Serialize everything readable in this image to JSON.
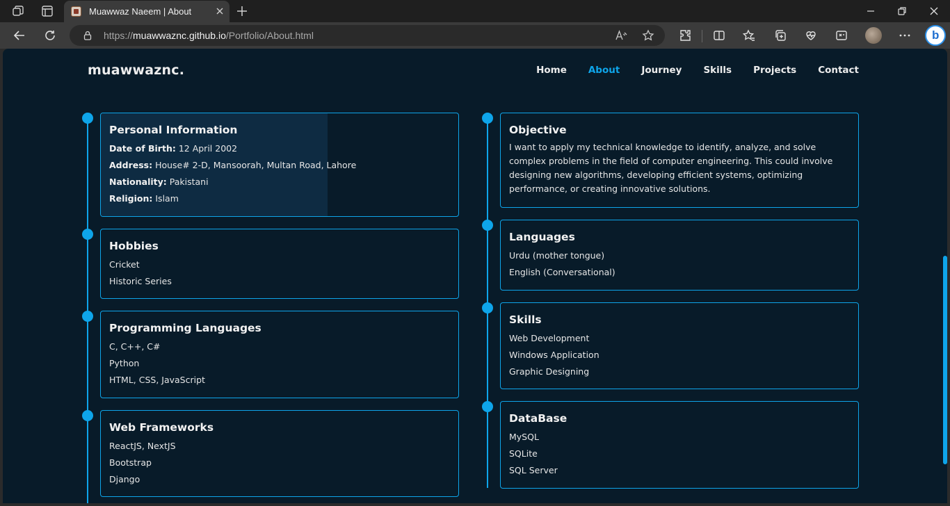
{
  "browser": {
    "tab_title": "Muawwaz Naeem | About",
    "url_host": "muawwaznc.github.io",
    "url_prefix": "https://",
    "url_path": "/Portfolio/About.html"
  },
  "site": {
    "logo": "muawwaznc.",
    "nav": [
      {
        "label": "Home"
      },
      {
        "label": "About"
      },
      {
        "label": "Journey"
      },
      {
        "label": "Skills"
      },
      {
        "label": "Projects"
      },
      {
        "label": "Contact"
      }
    ]
  },
  "cards": {
    "personal": {
      "title": "Personal Information",
      "rows": [
        {
          "key": "Date of Birth:",
          "value": " 12 April 2002"
        },
        {
          "key": "Address:",
          "value": " House# 2-D, Mansoorah, Multan Road, Lahore"
        },
        {
          "key": "Nationality:",
          "value": " Pakistani"
        },
        {
          "key": "Religion:",
          "value": " Islam"
        }
      ]
    },
    "hobbies": {
      "title": "Hobbies",
      "items": [
        "Cricket",
        "Historic Series"
      ]
    },
    "programming": {
      "title": "Programming Languages",
      "items": [
        "C, C++, C#",
        "Python",
        "HTML, CSS, JavaScript"
      ]
    },
    "frameworks": {
      "title": "Web Frameworks",
      "items": [
        "ReactJS, NextJS",
        "Bootstrap",
        "Django"
      ]
    },
    "objective": {
      "title": "Objective",
      "text": "I want to apply my technical knowledge to identify, analyze, and solve complex problems in the field of computer engineering. This could involve designing new algorithms, developing efficient systems, optimizing performance, or creating innovative solutions."
    },
    "languages": {
      "title": "Languages",
      "items": [
        "Urdu (mother tongue)",
        "English (Conversational)"
      ]
    },
    "skills": {
      "title": "Skills",
      "items": [
        "Web Development",
        "Windows Application",
        "Graphic Designing"
      ]
    },
    "database": {
      "title": "DataBase",
      "items": [
        "MySQL",
        "SQLite",
        "SQL Server"
      ]
    }
  },
  "colors": {
    "accent": "#0ea5ea",
    "background": "#081b29",
    "highlight": "#0e2b42"
  },
  "icons": [
    "workspaces-icon",
    "tab-actions-icon",
    "close-icon",
    "plus-icon",
    "minimize-icon",
    "restore-icon",
    "back-icon",
    "refresh-icon",
    "lock-icon",
    "read-aloud-icon",
    "star-icon",
    "extensions-icon",
    "split-screen-icon",
    "favorites-icon",
    "collections-icon",
    "performance-icon",
    "screenshot-icon",
    "more-icon",
    "bing-icon"
  ]
}
